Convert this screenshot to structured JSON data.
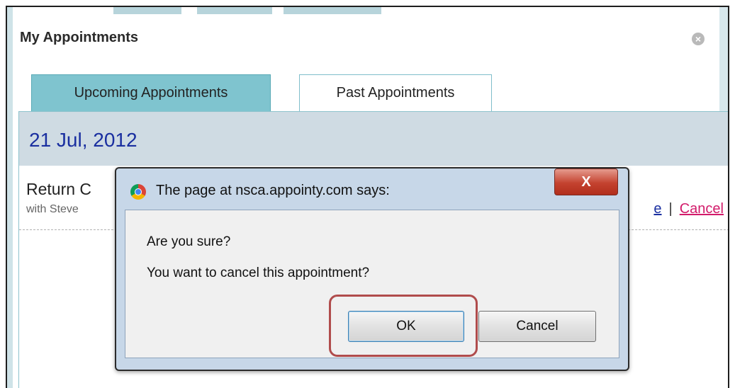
{
  "panel": {
    "title": "My Appointments",
    "close_label": "×",
    "tabs": [
      {
        "label": "Upcoming Appointments",
        "active": true
      },
      {
        "label": "Past Appointments",
        "active": false
      }
    ]
  },
  "appointment": {
    "date": "21 Jul, 2012",
    "title": "Return C",
    "with": "with Steve",
    "reschedule_label": "e",
    "separator": "|",
    "cancel_label": "Cancel"
  },
  "dialog": {
    "title": "The page at nsca.appointy.com says:",
    "close_label": "X",
    "line1": "Are you sure?",
    "line2": "You want to cancel this appointment?",
    "ok_label": "OK",
    "cancel_label": "Cancel"
  },
  "colors": {
    "tab_active": "#7fc4cf",
    "date_bar": "#cfdbe3",
    "date_text": "#1a2fa0",
    "cancel_link": "#d21a6a",
    "highlight": "#b04c4c"
  }
}
